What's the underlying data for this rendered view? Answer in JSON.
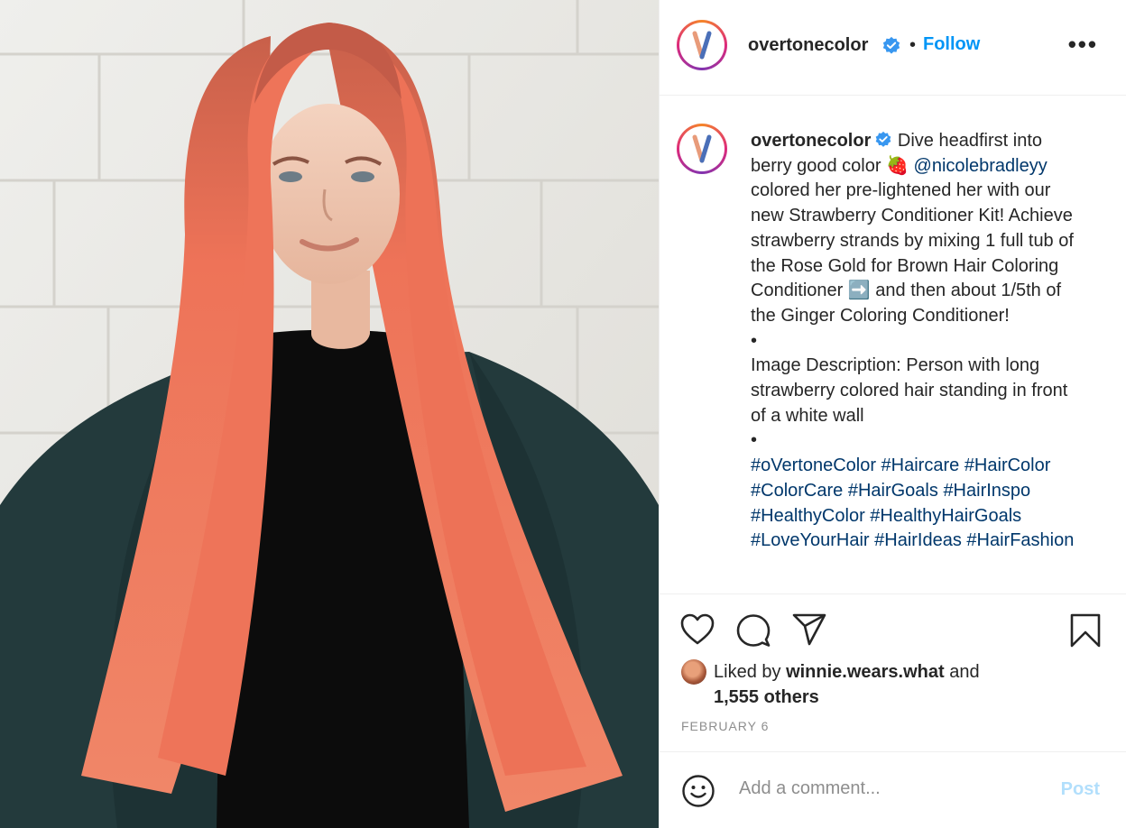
{
  "account": {
    "username": "overtonecolor",
    "verified": true,
    "separator": "•",
    "follow_label": "Follow",
    "more_label": "•••"
  },
  "caption": {
    "username": "overtonecolor",
    "line1_text": " Dive headfirst into berry good color ",
    "emoji1": "🍓",
    "mention": "@nicolebradleyy",
    "line2_text": " colored her pre-lightened her with our new Strawberry Conditioner Kit! Achieve strawberry strands by mixing 1 full tub of the Rose Gold for Brown Hair Coloring Conditioner ",
    "emoji2": "➡️",
    "line3_text": " and then about 1/5th of the Ginger Coloring Conditioner!",
    "bullet1": "•",
    "image_description": "Image Description: Person with long strawberry colored hair standing in front of a white wall",
    "bullet2": "•",
    "hashtags": [
      "#oVertoneColor",
      "#Haircare",
      "#HairColor",
      "#ColorCare",
      "#HairGoals",
      "#HairInspo",
      "#HealthyColor",
      "#HealthyHairGoals",
      "#LoveYourHair",
      "#HairIdeas",
      "#HairFashion"
    ]
  },
  "likes": {
    "prefix": "Liked by ",
    "liker": "winnie.wears.what",
    "middle": " and ",
    "others": "1,555 others"
  },
  "date": "FEBRUARY 6",
  "comment": {
    "placeholder": "Add a comment...",
    "post_label": "Post"
  },
  "icons": [
    "heart-icon",
    "comment-icon",
    "share-icon",
    "bookmark-icon",
    "emoji-icon",
    "verified-icon",
    "more-icon"
  ],
  "colors": {
    "link": "#00376b",
    "follow": "#0095f6",
    "post_disabled": "#b2dffc",
    "muted": "#8e8e8e",
    "text": "#262626"
  }
}
